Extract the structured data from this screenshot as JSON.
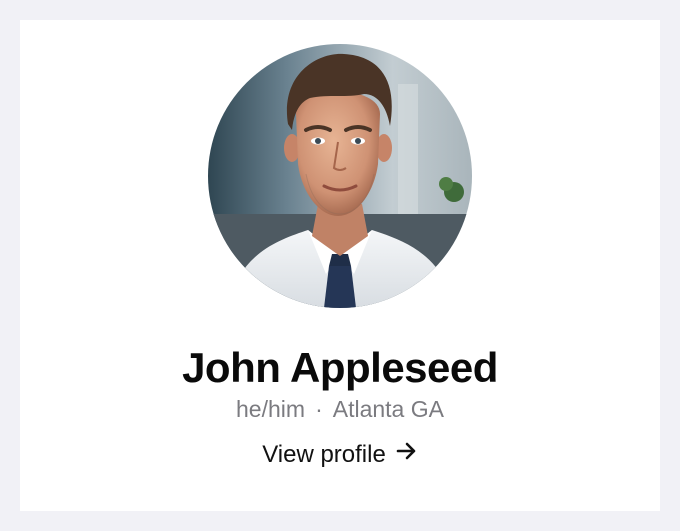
{
  "profile": {
    "name": "John Appleseed",
    "pronouns": "he/him",
    "separator": "·",
    "location": "Atlanta GA",
    "view_profile_label": "View profile",
    "avatar_alt": "Profile photo"
  },
  "icons": {
    "view_profile": "arrow-right-icon"
  },
  "colors": {
    "page_background": "#f1f1f6",
    "card_background": "#ffffff",
    "name_text": "#0a0a0a",
    "meta_text": "#7b7b80",
    "link_text": "#111111"
  }
}
